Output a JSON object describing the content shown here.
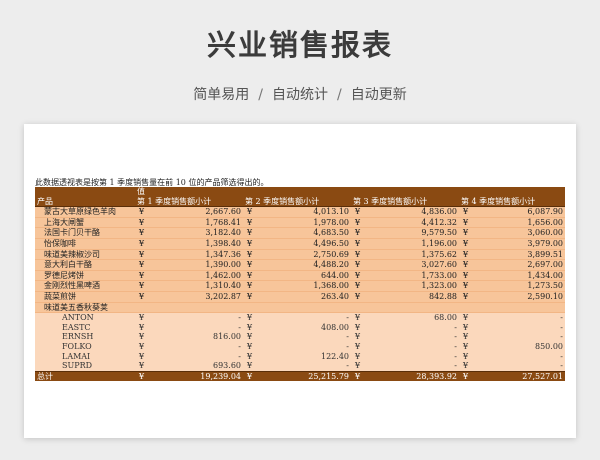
{
  "header": {
    "title": "兴业销售报表",
    "subtitle_items": [
      "简单易用",
      "自动统计",
      "自动更新"
    ],
    "separator": "/"
  },
  "report": {
    "note": "此数据透视表是按第 1 季度销售量在前 10 位的产品筛选得出的。",
    "value_label": "值",
    "row_label": "产品",
    "columns": [
      "第 1 季度销售额小计",
      "第 2 季度销售额小计",
      "第 3 季度销售额小计",
      "第 4 季度销售额小计"
    ],
    "currency": "¥",
    "products": [
      {
        "name": "蒙古大草原绿色羊肉",
        "values": [
          "2,667.60",
          "4,013.10",
          "4,836.00",
          "6,087.90"
        ]
      },
      {
        "name": "上海大闸蟹",
        "values": [
          "1,768.41",
          "1,978.00",
          "4,412.32",
          "1,656.00"
        ]
      },
      {
        "name": "法国卡门贝干酪",
        "values": [
          "3,182.40",
          "4,683.50",
          "9,579.50",
          "3,060.00"
        ]
      },
      {
        "name": "怡保咖啡",
        "values": [
          "1,398.40",
          "4,496.50",
          "1,196.00",
          "3,979.00"
        ]
      },
      {
        "name": "味道美辣椒沙司",
        "values": [
          "1,347.36",
          "2,750.69",
          "1,375.62",
          "3,899.51"
        ]
      },
      {
        "name": "意大利白干酪",
        "values": [
          "1,390.00",
          "4,488.20",
          "3,027.60",
          "2,697.00"
        ]
      },
      {
        "name": "罗德尼烤饼",
        "values": [
          "1,462.00",
          "644.00",
          "1,733.00",
          "1,434.00"
        ]
      },
      {
        "name": "金刚烈性黑啤酒",
        "values": [
          "1,310.40",
          "1,368.00",
          "1,323.00",
          "1,273.50"
        ]
      },
      {
        "name": "蔬菜煎饼",
        "values": [
          "3,202.87",
          "263.40",
          "842.88",
          "2,590.10"
        ]
      }
    ],
    "expanded_product": "味道美五香秋葵荚",
    "suppliers": [
      {
        "name": "ANTON",
        "values": [
          "-",
          "-",
          "68.00",
          "-"
        ]
      },
      {
        "name": "EASTC",
        "values": [
          "-",
          "408.00",
          "-",
          "-"
        ]
      },
      {
        "name": "ERNSH",
        "values": [
          "816.00",
          "-",
          "-",
          "-"
        ]
      },
      {
        "name": "FOLKO",
        "values": [
          "-",
          "-",
          "-",
          "850.00"
        ]
      },
      {
        "name": "LAMAI",
        "values": [
          "-",
          "122.40",
          "-",
          "-"
        ]
      },
      {
        "name": "SUPRD",
        "values": [
          "693.60",
          "-",
          "-",
          "-"
        ]
      }
    ],
    "total_label": "总计",
    "totals": [
      "19,239.04",
      "25,215.79",
      "28,393.92",
      "27,527.01"
    ]
  }
}
